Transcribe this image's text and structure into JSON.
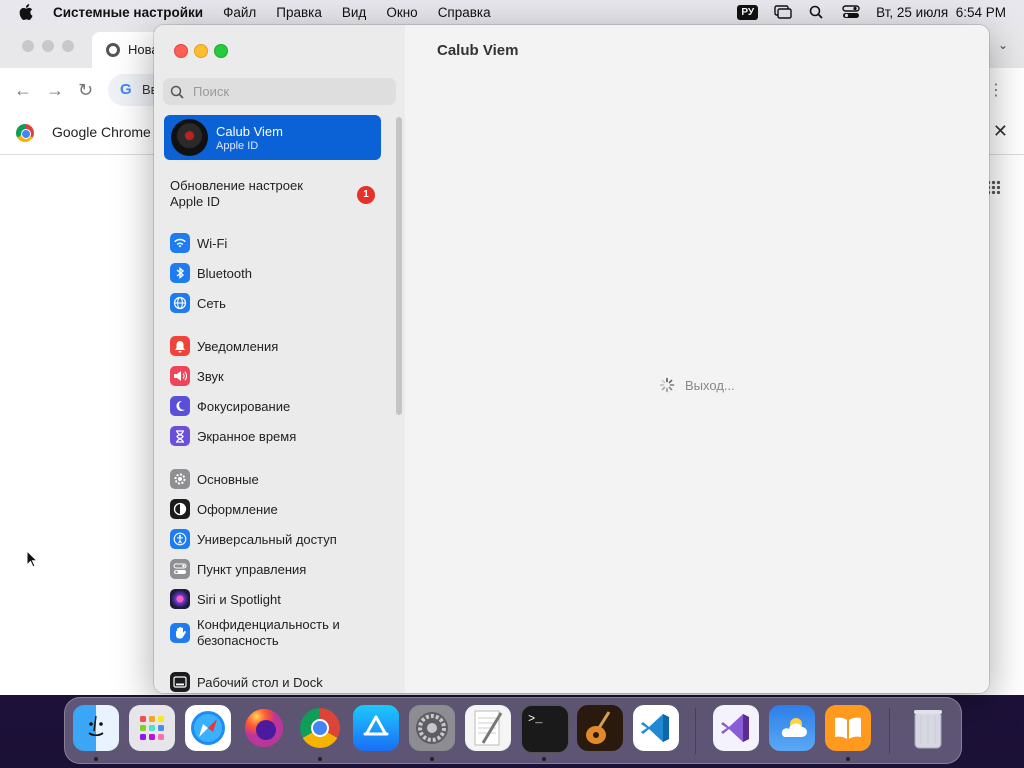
{
  "menubar": {
    "app_name": "Системные настройки",
    "menus": [
      "Файл",
      "Правка",
      "Вид",
      "Окно",
      "Справка"
    ],
    "language": "РУ",
    "datetime": "Вт, 25 июля  6:54 PM"
  },
  "chrome": {
    "tab_title": "Нова",
    "omnibox_text": "Вв",
    "infobar_text": "Google Chrome и"
  },
  "settings": {
    "search_placeholder": "Поиск",
    "account": {
      "name": "Calub Viem",
      "subtitle": "Apple ID"
    },
    "update": {
      "label": "Обновление настроек Apple ID",
      "badge": "1"
    },
    "groups": [
      {
        "items": [
          {
            "label": "Wi-Fi",
            "icon": "wifi-icon",
            "color": "#1e7cf0"
          },
          {
            "label": "Bluetooth",
            "icon": "bluetooth-icon",
            "color": "#1e7cf0"
          },
          {
            "label": "Сеть",
            "icon": "globe-icon",
            "color": "#1e7cf0"
          }
        ]
      },
      {
        "items": [
          {
            "label": "Уведомления",
            "icon": "bell-icon",
            "color": "#f0443a"
          },
          {
            "label": "Звук",
            "icon": "speaker-icon",
            "color": "#f0445b"
          },
          {
            "label": "Фокусирование",
            "icon": "moon-icon",
            "color": "#5b4fd8"
          },
          {
            "label": "Экранное время",
            "icon": "hourglass-icon",
            "color": "#6b4fd8"
          }
        ]
      },
      {
        "items": [
          {
            "label": "Основные",
            "icon": "gear-icon",
            "color": "#8e8e93"
          },
          {
            "label": "Оформление",
            "icon": "appearance-icon",
            "color": "#1c1c1e"
          },
          {
            "label": "Универсальный доступ",
            "icon": "accessibility-icon",
            "color": "#1e7cf0"
          },
          {
            "label": "Пункт управления",
            "icon": "control-center-icon",
            "color": "#8e8e93"
          },
          {
            "label": "Siri и Spotlight",
            "icon": "siri-icon",
            "color": "#7b3fd1"
          },
          {
            "label": "Конфиденциальность и безопасность",
            "icon": "hand-icon",
            "color": "#1e7cf0"
          }
        ]
      },
      {
        "items": [
          {
            "label": "Рабочий стол и Dock",
            "icon": "dock-icon",
            "color": "#1c1c1e"
          }
        ]
      }
    ],
    "content_title": "Calub Viem",
    "loading_text": "Выход..."
  },
  "dock": {
    "apps": [
      {
        "name": "Finder",
        "icon": "finder-icon",
        "running": true
      },
      {
        "name": "Launchpad",
        "icon": "launchpad-icon",
        "running": false
      },
      {
        "name": "Safari",
        "icon": "safari-icon",
        "running": false
      },
      {
        "name": "Firefox",
        "icon": "firefox-icon",
        "running": false
      },
      {
        "name": "Google Chrome",
        "icon": "chrome-icon",
        "running": true
      },
      {
        "name": "App Store",
        "icon": "app-store-icon",
        "running": false
      },
      {
        "name": "System Settings",
        "icon": "system-settings-icon",
        "running": true
      },
      {
        "name": "Script Editor",
        "icon": "script-editor-icon",
        "running": false
      },
      {
        "name": "Terminal",
        "icon": "terminal-icon",
        "running": true
      },
      {
        "name": "GarageBand",
        "icon": "garageband-icon",
        "running": false
      },
      {
        "name": "Visual Studio Code",
        "icon": "vscode-icon",
        "running": false
      },
      {
        "name": "Visual Studio",
        "icon": "visual-studio-icon",
        "running": false
      },
      {
        "name": "Weather",
        "icon": "weather-icon",
        "running": false
      },
      {
        "name": "Books",
        "icon": "books-icon",
        "running": true
      },
      {
        "name": "Trash",
        "icon": "trash-icon",
        "running": false
      }
    ]
  }
}
